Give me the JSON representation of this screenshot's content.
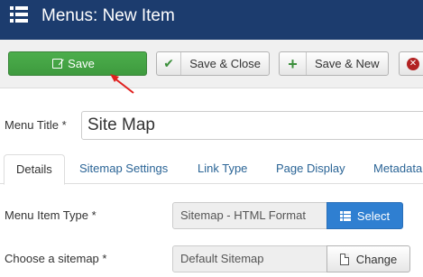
{
  "header": {
    "title": "Menus: New Item",
    "icon": "menu-list-icon"
  },
  "toolbar": {
    "save_label": "Save",
    "save_close_label": "Save & Close",
    "save_new_label": "Save & New",
    "colors": {
      "save": "#47a447",
      "brand": "#1c3c6e"
    }
  },
  "form": {
    "menu_title_label": "Menu Title *",
    "menu_title_value": "Site Map",
    "tabs": [
      {
        "label": "Details"
      },
      {
        "label": "Sitemap Settings"
      },
      {
        "label": "Link Type"
      },
      {
        "label": "Page Display"
      },
      {
        "label": "Metadata"
      }
    ],
    "menu_item_type_label": "Menu Item Type *",
    "menu_item_type_value": "Sitemap - HTML Format",
    "select_label": "Select",
    "sitemap_label": "Choose a sitemap *",
    "sitemap_value": "Default Sitemap",
    "change_label": "Change"
  }
}
